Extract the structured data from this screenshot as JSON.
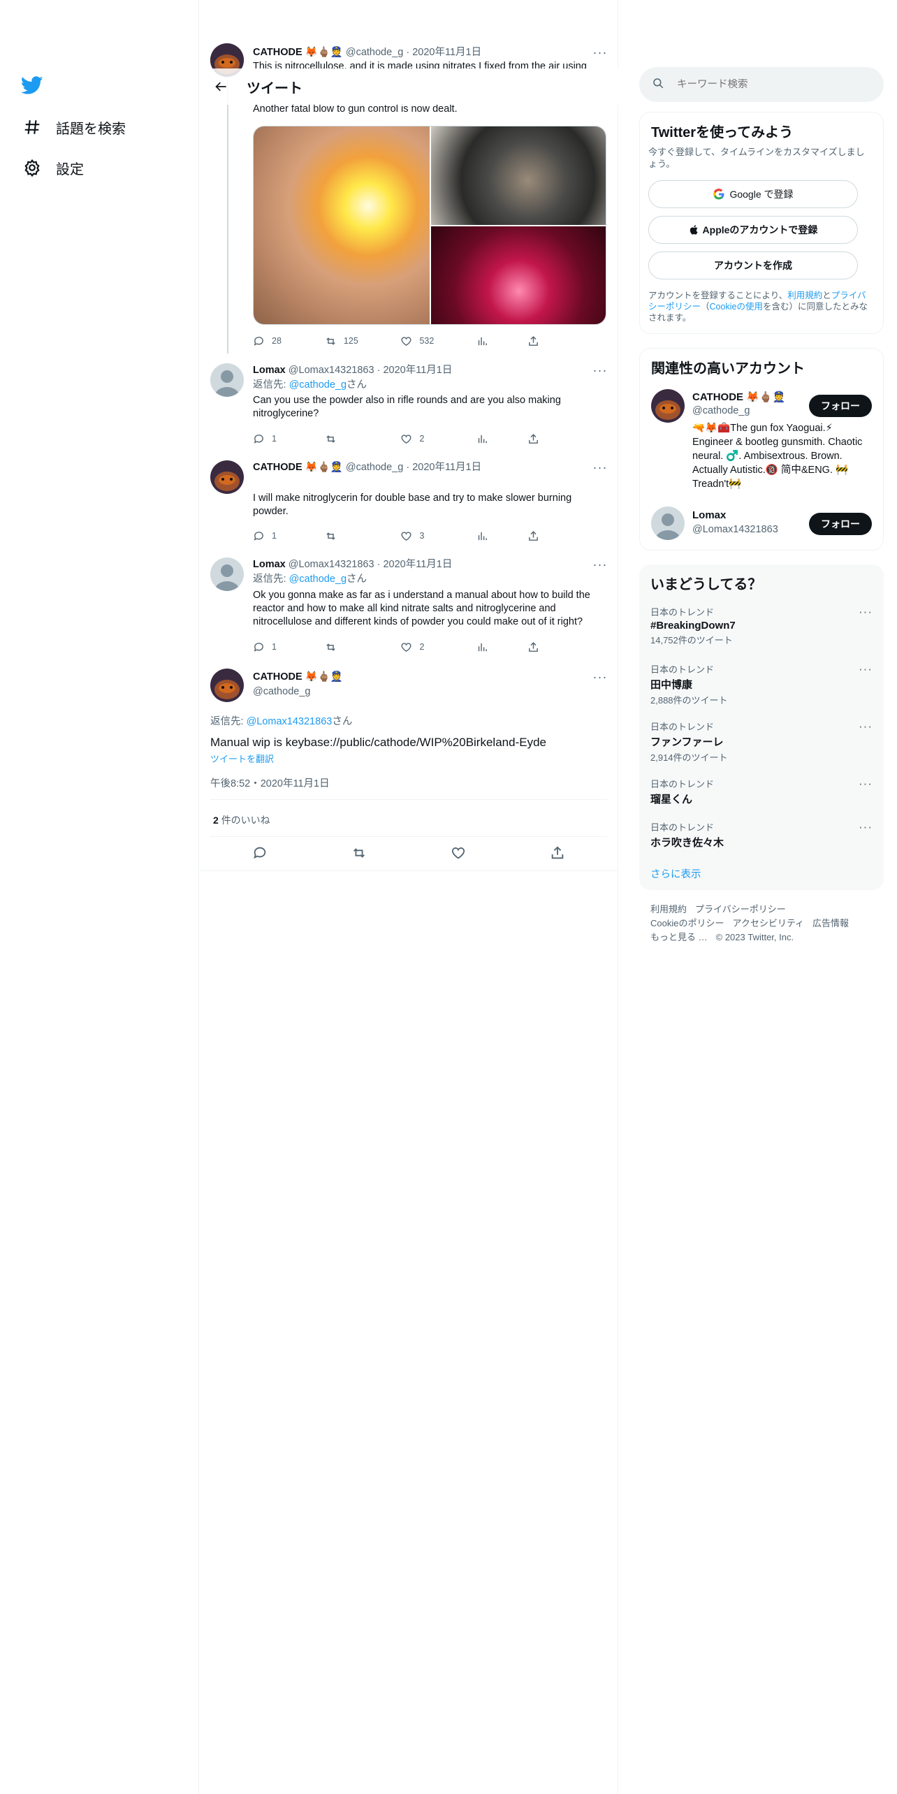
{
  "nav": {
    "items": [
      {
        "label": "話題を検索"
      },
      {
        "label": "設定"
      }
    ]
  },
  "header": {
    "title": "ツイート"
  },
  "tweets": [
    {
      "name": "CATHODE 🦊🖕🏽👮",
      "handle": "@cathode_g",
      "date": "2020年11月1日",
      "text_clipped": "This is nitrocellulose, and it is made using nitrates I fixed from the air using",
      "text": "Another fatal blow to gun control is now dealt.",
      "replies": "28",
      "retweets": "125",
      "likes": "532"
    },
    {
      "name": "Lomax",
      "handle": "@Lomax14321863",
      "date": "2020年11月1日",
      "reply_prefix": "返信先: ",
      "reply_to": "@cathode_g",
      "reply_suffix": "さん",
      "text": "Can you use the powder also in rifle rounds and are you also making nitroglycerine?",
      "replies": "1",
      "retweets": "",
      "likes": "2"
    },
    {
      "name": "CATHODE 🦊🖕🏽👮",
      "handle": "@cathode_g",
      "date": "2020年11月1日",
      "text": "I will make nitroglycerin for double base and try to make slower burning powder.",
      "replies": "1",
      "retweets": "",
      "likes": "3"
    },
    {
      "name": "Lomax",
      "handle": "@Lomax14321863",
      "date": "2020年11月1日",
      "reply_prefix": "返信先: ",
      "reply_to": "@cathode_g",
      "reply_suffix": "さん",
      "text": "Ok you gonna make as far as i understand a manual about how to build the reactor and how to make all kind nitrate salts and nitroglycerine and nitrocellulose and different kinds of powder you could make out of it right?",
      "replies": "1",
      "retweets": "",
      "likes": "2"
    }
  ],
  "focal": {
    "name": "CATHODE 🦊🖕🏽👮",
    "handle": "@cathode_g",
    "reply_prefix": "返信先: ",
    "reply_to": "@Lomax14321863",
    "reply_suffix": "さん",
    "text": "Manual wip is keybase://public/cathode/WIP%20Birkeland-Eyde",
    "translate": "ツイートを翻訳",
    "timestamp": "午後8:52・2020年11月1日",
    "likes_count": "2",
    "likes_label": "件のいいね"
  },
  "sidebar": {
    "search_placeholder": "キーワード検索",
    "signup": {
      "title": "Twitterを使ってみよう",
      "subtitle": "今すぐ登録して、タイムラインをカスタマイズしましょう。",
      "google": "Google で登録",
      "apple": "Appleのアカウントで登録",
      "create": "アカウントを作成",
      "legal_1": "アカウントを登録することにより、",
      "legal_terms": "利用規約",
      "legal_2": "と",
      "legal_privacy": "プライバシーポリシー",
      "legal_3": "（",
      "legal_cookie": "Cookieの使用",
      "legal_4": "を含む）に同意したとみなされます。"
    },
    "relevant": {
      "title": "関連性の高いアカウント",
      "follow_label": "フォロー",
      "accounts": [
        {
          "name": "CATHODE 🦊🖕🏽👮",
          "handle": "@cathode_g",
          "bio": "🔫🦊🧰The gun fox Yaoguai.⚡ Engineer & bootleg gunsmith. Chaotic neural. ♂️. Ambisextrous. Brown. Actually Autistic.🔞 简中&ENG. 🚧 Treadn't🚧"
        },
        {
          "name": "Lomax",
          "handle": "@Lomax14321863",
          "bio": ""
        }
      ]
    },
    "trends": {
      "title": "いまどうしてる？",
      "items": [
        {
          "category": "日本のトレンド",
          "name": "#BreakingDown7",
          "count": "14,752件のツイート"
        },
        {
          "category": "日本のトレンド",
          "name": "田中博康",
          "count": "2,888件のツイート"
        },
        {
          "category": "日本のトレンド",
          "name": "ファンファーレ",
          "count": "2,914件のツイート"
        },
        {
          "category": "日本のトレンド",
          "name": "瑠星くん",
          "count": ""
        },
        {
          "category": "日本のトレンド",
          "name": "ホラ吹き佐々木",
          "count": ""
        }
      ],
      "show_more": "さらに表示"
    },
    "footer": {
      "terms": "利用規約",
      "privacy": "プライバシーポリシー",
      "cookie": "Cookieのポリシー",
      "accessibility": "アクセシビリティ",
      "ads": "広告情報",
      "more": "もっと見る …",
      "copyright": "© 2023 Twitter, Inc."
    }
  },
  "colors": {
    "accent": "#1d9bf0",
    "text": "#0f1419",
    "muted": "#536471",
    "border": "#eff3f4"
  }
}
